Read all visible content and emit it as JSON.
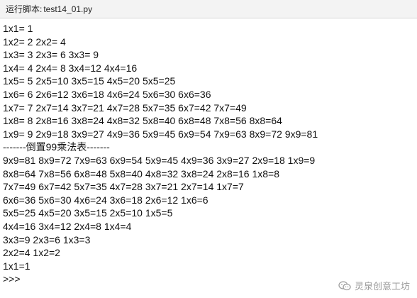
{
  "window": {
    "title_prefix": "运行脚本:",
    "script_name": "test14_01.py"
  },
  "console": {
    "lines": [
      "1x1= 1",
      "1x2= 2 2x2= 4",
      "1x3= 3 2x3= 6 3x3= 9",
      "1x4= 4 2x4= 8 3x4=12 4x4=16",
      "1x5= 5 2x5=10 3x5=15 4x5=20 5x5=25",
      "1x6= 6 2x6=12 3x6=18 4x6=24 5x6=30 6x6=36",
      "1x7= 7 2x7=14 3x7=21 4x7=28 5x7=35 6x7=42 7x7=49",
      "1x8= 8 2x8=16 3x8=24 4x8=32 5x8=40 6x8=48 7x8=56 8x8=64",
      "1x9= 9 2x9=18 3x9=27 4x9=36 5x9=45 6x9=54 7x9=63 8x9=72 9x9=81",
      "-------倒置99乘法表-------",
      "9x9=81 8x9=72 7x9=63 6x9=54 5x9=45 4x9=36 3x9=27 2x9=18 1x9=9",
      "8x8=64 7x8=56 6x8=48 5x8=40 4x8=32 3x8=24 2x8=16 1x8=8",
      "7x7=49 6x7=42 5x7=35 4x7=28 3x7=21 2x7=14 1x7=7",
      "6x6=36 5x6=30 4x6=24 3x6=18 2x6=12 1x6=6",
      "5x5=25 4x5=20 3x5=15 2x5=10 1x5=5",
      "4x4=16 3x4=12 2x4=8 1x4=4",
      "3x3=9 2x3=6 1x3=3",
      "2x2=4 1x2=2",
      "1x1=1",
      ">>>"
    ]
  },
  "watermark": {
    "text": "灵泉创意工坊",
    "icon": "wechat-icon"
  }
}
